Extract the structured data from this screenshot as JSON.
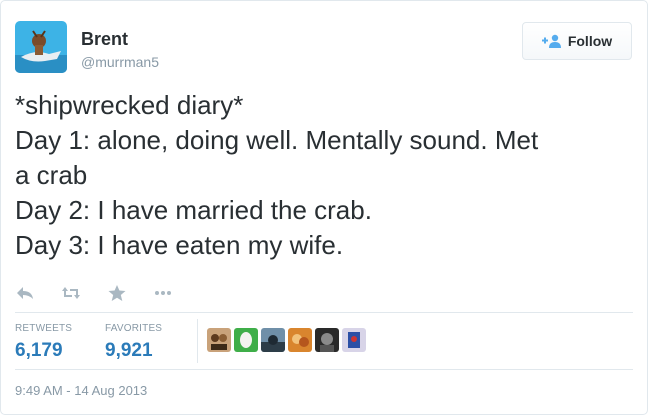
{
  "tweet": {
    "author_name": "Brent",
    "author_handle": "@murrman5",
    "follow_label": "Follow",
    "text_lines": [
      "*shipwrecked diary*",
      "Day 1: alone, doing well. Mentally sound. Met",
      "a crab",
      "Day 2: I have married the crab.",
      "Day 3: I have eaten my wife."
    ],
    "actions": [
      "reply-icon",
      "retweet-icon",
      "favorite-icon",
      "more-icon"
    ],
    "stats": {
      "retweets_label": "RETWEETS",
      "retweets_count": "6,179",
      "favorites_label": "FAVORITES",
      "favorites_count": "9,921"
    },
    "timestamp": "9:49 AM - 14 Aug 2013"
  },
  "colors": {
    "text": "#292f33",
    "muted": "#8899a6",
    "link_blue": "#2b7bb9",
    "icon_gray": "#aab8c2",
    "border": "#e1e8ed"
  }
}
